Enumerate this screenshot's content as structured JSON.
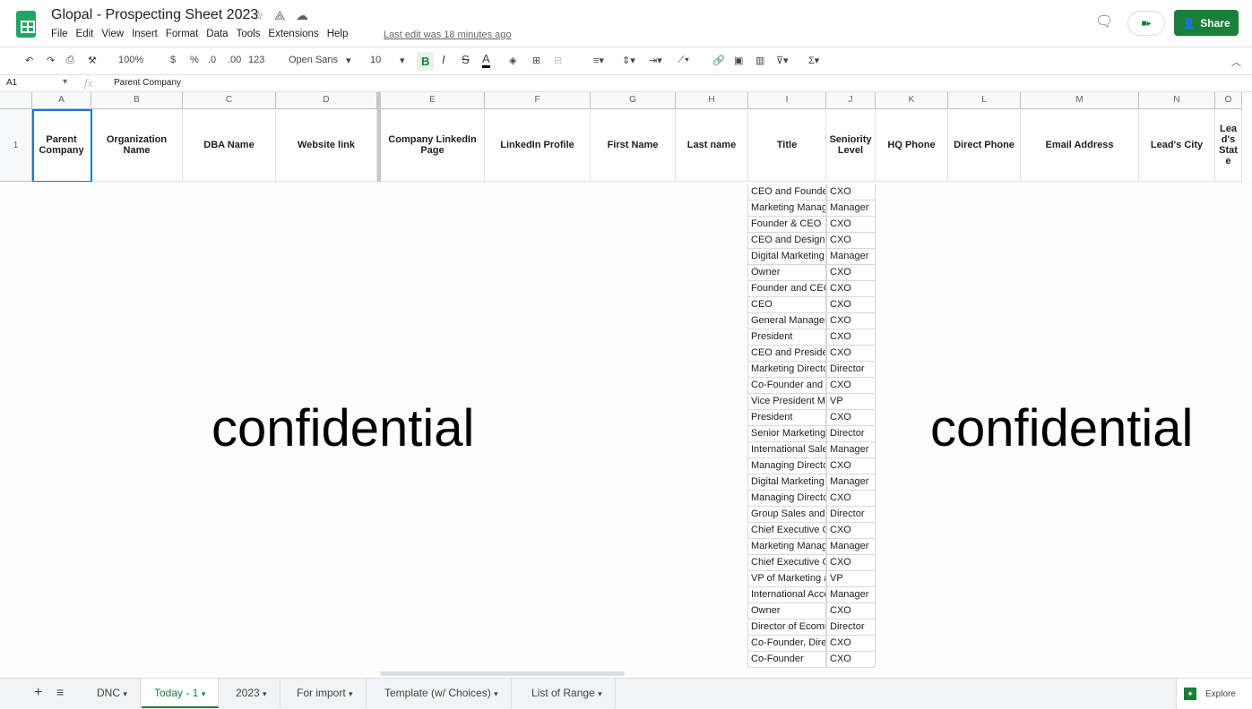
{
  "app": {
    "title": "Glopal - Prospecting Sheet 2023",
    "last_edit": "Last edit was 18 minutes ago",
    "share_label": "Share",
    "explore_label": "Explore"
  },
  "menu": [
    "File",
    "Edit",
    "View",
    "Insert",
    "Format",
    "Data",
    "Tools",
    "Extensions",
    "Help"
  ],
  "toolbar": {
    "zoom": "100%",
    "currency": "$",
    "percent": "%",
    "dec_less": ".0",
    "dec_more": ".00",
    "format": "123",
    "font": "Open Sans",
    "size": "10",
    "bold": "B",
    "italic": "I",
    "strike": "S",
    "textcolor": "A"
  },
  "formula": {
    "cell_ref": "A1",
    "fx": "fx",
    "value": "Parent Company"
  },
  "columns": [
    "A",
    "B",
    "C",
    "D",
    "E",
    "F",
    "G",
    "H",
    "I",
    "J",
    "K",
    "L",
    "M",
    "N",
    "O"
  ],
  "row_number": "1",
  "headers": [
    "Parent Company",
    "Organization Name",
    "DBA Name",
    "Website link",
    "Company LinkedIn Page",
    "LinkedIn Profile",
    "First Name",
    "Last name",
    "Title",
    "Seniority Level",
    "HQ Phone",
    "Direct Phone",
    "Email Address",
    "Lead's City",
    "Lea d's Stat e"
  ],
  "overlay_text": "confidential",
  "rows": [
    [
      "CEO and Founder",
      "CXO"
    ],
    [
      "Marketing Manager",
      "Manager"
    ],
    [
      "Founder & CEO",
      "CXO"
    ],
    [
      "CEO and Designer",
      "CXO"
    ],
    [
      "Digital Marketing",
      "Manager"
    ],
    [
      "Owner",
      "CXO"
    ],
    [
      "Founder and CEO",
      "CXO"
    ],
    [
      "CEO",
      "CXO"
    ],
    [
      "General Manager",
      "CXO"
    ],
    [
      "President",
      "CXO"
    ],
    [
      "CEO and President",
      "CXO"
    ],
    [
      "Marketing Director",
      "Director"
    ],
    [
      "Co-Founder and CEO",
      "CXO"
    ],
    [
      "Vice President Marketing",
      "VP"
    ],
    [
      "President",
      "CXO"
    ],
    [
      "Senior Marketing",
      "Director"
    ],
    [
      "International Sales",
      "Manager"
    ],
    [
      "Managing Director",
      "CXO"
    ],
    [
      "Digital Marketing",
      "Manager"
    ],
    [
      "Managing Director",
      "CXO"
    ],
    [
      "Group Sales and",
      "Director"
    ],
    [
      "Chief Executive Officer",
      "CXO"
    ],
    [
      "Marketing Manager",
      "Manager"
    ],
    [
      "Chief Executive Officer",
      "CXO"
    ],
    [
      "VP of Marketing and",
      "VP"
    ],
    [
      "International Account",
      "Manager"
    ],
    [
      "Owner",
      "CXO"
    ],
    [
      "Director of Ecommerce",
      "Director"
    ],
    [
      "Co-Founder, Director",
      "CXO"
    ],
    [
      "Co-Founder",
      "CXO"
    ]
  ],
  "sheets": [
    "DNC",
    "Today - 1",
    "2023",
    "For import",
    "Template (w/ Choices)",
    "List  of Range"
  ],
  "active_sheet": "Today - 1"
}
